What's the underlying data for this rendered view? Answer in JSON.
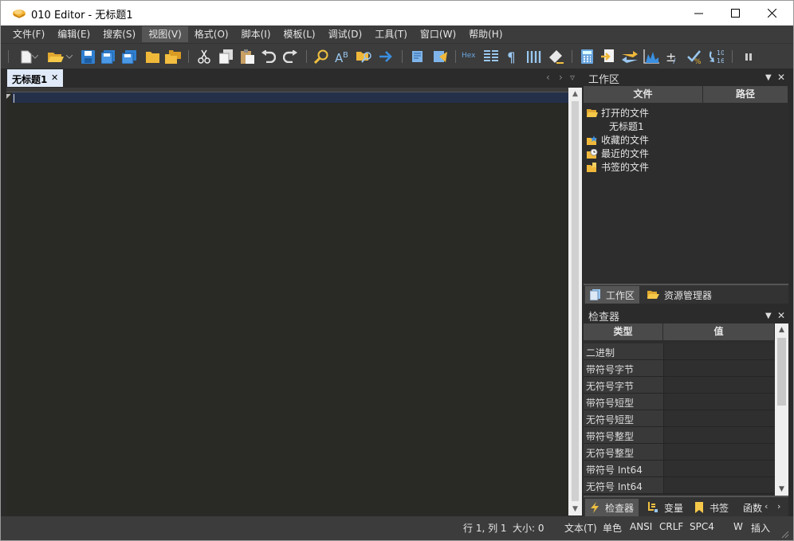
{
  "window": {
    "title": "010 Editor - 无标题1",
    "minimize": "—",
    "maximize": "☐",
    "close": "✕"
  },
  "menu": [
    {
      "label": "文件(F)"
    },
    {
      "label": "编辑(E)"
    },
    {
      "label": "搜索(S)"
    },
    {
      "label": "视图(V)",
      "active": true
    },
    {
      "label": "格式(O)"
    },
    {
      "label": "脚本(I)"
    },
    {
      "label": "模板(L)"
    },
    {
      "label": "调试(D)"
    },
    {
      "label": "工具(T)"
    },
    {
      "label": "窗口(W)"
    },
    {
      "label": "帮助(H)"
    }
  ],
  "toolbar": {
    "hex_label": "Hex"
  },
  "editor": {
    "tab_label": "无标题1",
    "tab_close": "✕",
    "tab_prev": "‹",
    "tab_next": "›",
    "tab_list": "▿"
  },
  "workspace": {
    "title": "工作区",
    "col_file": "文件",
    "col_path": "路径",
    "items": {
      "open_files": "打开的文件",
      "open_untitled": "无标题1",
      "favorites": "收藏的文件",
      "recent": "最近的文件",
      "bookmarked": "书签的文件"
    },
    "tab_workspace": "工作区",
    "tab_explorer": "资源管理器"
  },
  "inspector": {
    "title": "检查器",
    "col_type": "类型",
    "col_value": "值",
    "rows": [
      "二进制",
      "带符号字节",
      "无符号字节",
      "带符号短型",
      "无符号短型",
      "带符号整型",
      "无符号整型",
      "带符号 Int64",
      "无符号 Int64"
    ],
    "tab_inspector": "检查器",
    "tab_vars": "变量",
    "tab_bookmarks": "书签",
    "tab_functions": "函数"
  },
  "status": {
    "position": "行 1, 列 1",
    "size": "大小: 0",
    "mode": "文本(T)",
    "color": "单色",
    "encoding": "ANSI",
    "line_end": "CRLF",
    "tab_setting": "SPC4",
    "write": "W",
    "insert": "插入"
  }
}
